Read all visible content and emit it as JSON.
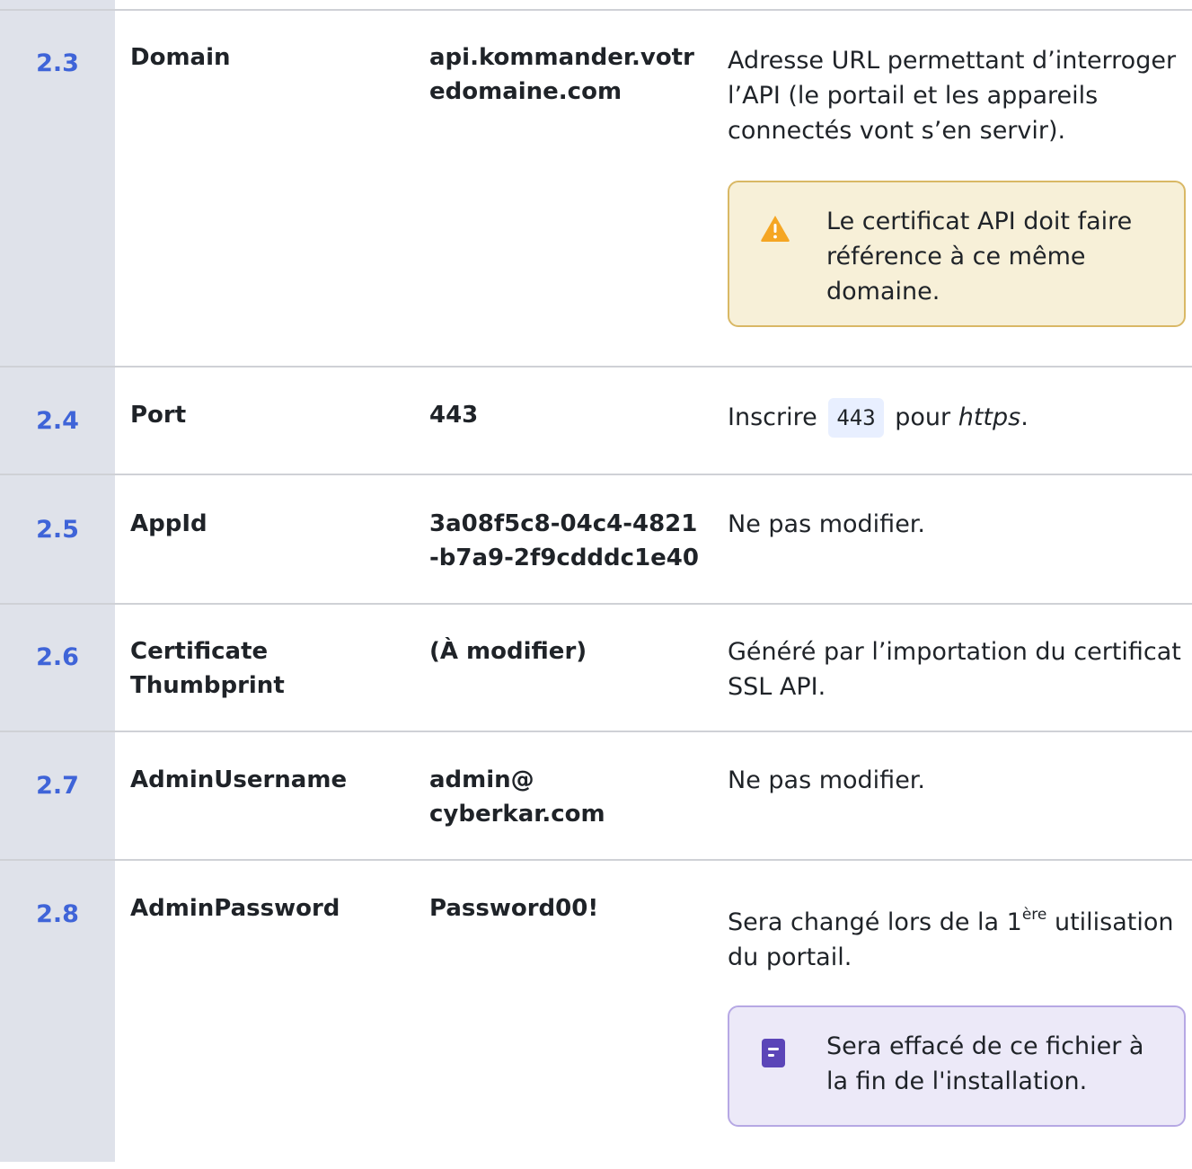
{
  "rows": [
    {
      "num": "2.3",
      "name": "Domain",
      "value": "api.kommander.votredomaine.com",
      "description": "Adresse URL permettant d’interroger l’API (le portail et les appareils connectés vont s’en servir).",
      "callout": {
        "kind": "warning",
        "icon": "warning-icon",
        "text": "Le certificat API doit faire référence à ce même domaine."
      }
    },
    {
      "num": "2.4",
      "name": "Port",
      "value": "443",
      "description_prefix": "Inscrire",
      "description_code": "443",
      "description_middle": "pour",
      "description_em": "https",
      "description_suffix": "."
    },
    {
      "num": "2.5",
      "name": "AppId",
      "value": "3a08f5c8-04c4-4821-b7a9-2f9cdddc1e40",
      "description": "Ne pas modifier."
    },
    {
      "num": "2.6",
      "name": "Certificate Thumbprint",
      "value": "(À modifier)",
      "description": "Généré par l’importation du certificat SSL API."
    },
    {
      "num": "2.7",
      "name": "AdminUsername",
      "value_line1": "admin@",
      "value_line2": "cyberkar.com",
      "description": "Ne pas modifier."
    },
    {
      "num": "2.8",
      "name": "AdminPassword",
      "value": "Password00!",
      "description_prefix": "Sera changé lors de la 1",
      "description_sup": "ère",
      "description_suffix": " utilisation du portail.",
      "callout": {
        "kind": "note",
        "icon": "note-icon",
        "text": "Sera effacé de ce fichier à la fin de l'installation."
      }
    }
  ],
  "colors": {
    "number": "#3f64d8",
    "gutter": "#dfe2ea",
    "warning_bg": "#f7f0d8",
    "warning_border": "#d9b865",
    "warning_icon": "#f5a623",
    "note_bg": "#ece9f8",
    "note_border": "#b6a8e4",
    "note_icon": "#5b45b8",
    "code_bg": "#e8efff"
  }
}
